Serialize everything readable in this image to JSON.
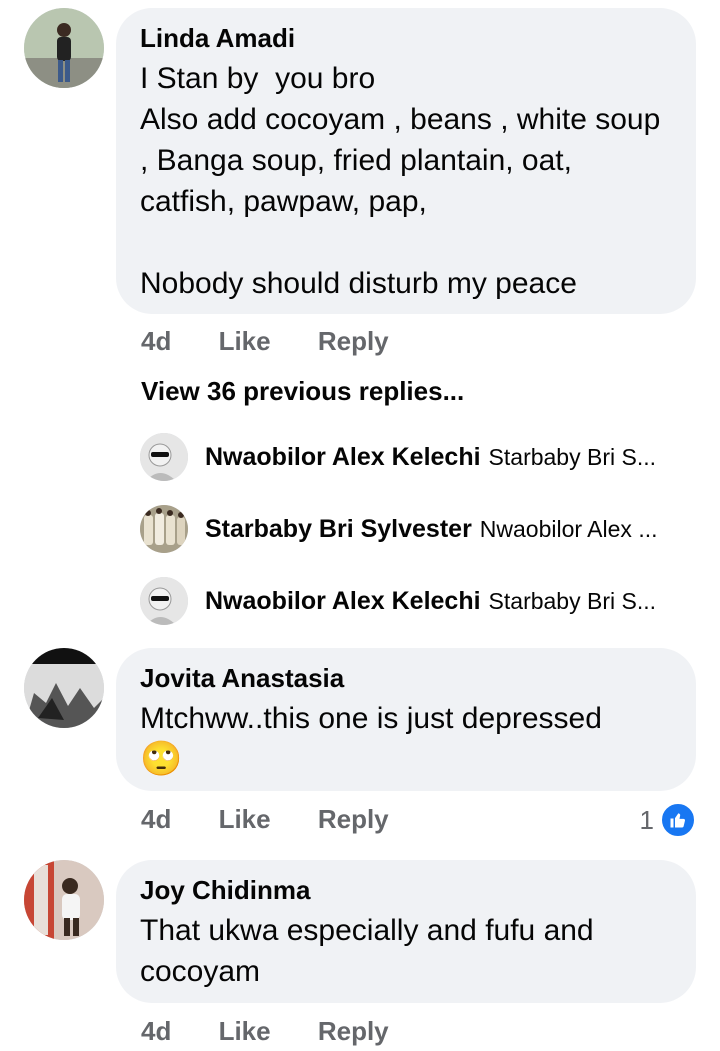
{
  "comments": [
    {
      "author": "Linda Amadi",
      "text": "I Stan by  you bro\nAlso add cocoyam , beans , white soup , Banga soup, fried plantain, oat, catfish, pawpaw, pap,\n\nNobody should disturb my peace",
      "time": "4d",
      "like_label": "Like",
      "reply_label": "Reply"
    },
    {
      "author": "Jovita Anastasia",
      "text": "Mtchww..this one is just depressed",
      "emoji": "🙄",
      "time": "4d",
      "like_label": "Like",
      "reply_label": "Reply",
      "reaction_count": "1"
    },
    {
      "author": "Joy Chidinma",
      "text": "That ukwa especially and fufu and cocoyam",
      "time": "4d",
      "like_label": "Like",
      "reply_label": "Reply"
    }
  ],
  "view_previous_label": "View 36 previous replies...",
  "replies": [
    {
      "author": "Nwaobilor Alex Kelechi",
      "snippet": "Starbaby Bri S..."
    },
    {
      "author": "Starbaby Bri Sylvester",
      "snippet": "Nwaobilor Alex ..."
    },
    {
      "author": "Nwaobilor Alex Kelechi",
      "snippet": "Starbaby Bri S..."
    }
  ],
  "colors": {
    "bubble": "#f0f2f5",
    "meta": "#65676b",
    "like_blue": "#1877f2"
  },
  "icons": {
    "reaction": "thumbs-up-icon"
  }
}
